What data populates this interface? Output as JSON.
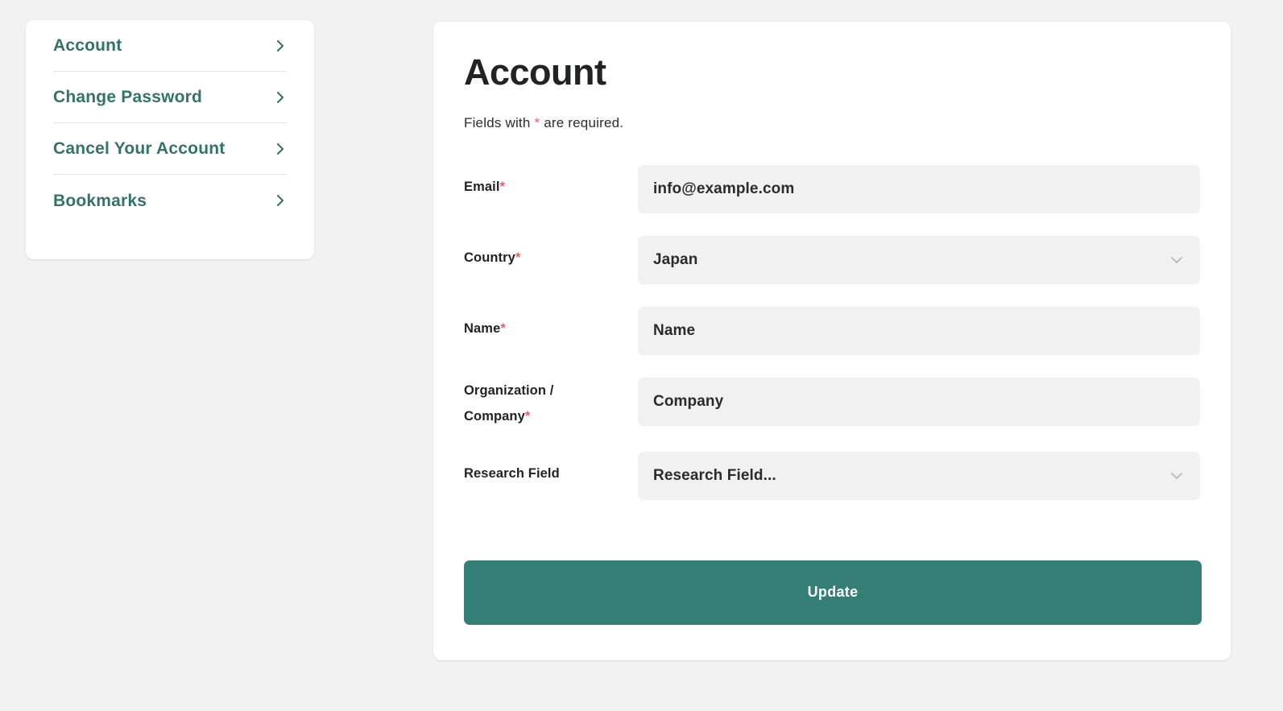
{
  "sidebar": {
    "items": [
      {
        "label": "Account",
        "icon": "chevron-right-icon"
      },
      {
        "label": "Change Password",
        "icon": "chevron-right-icon"
      },
      {
        "label": "Cancel Your Account",
        "icon": "chevron-right-icon"
      },
      {
        "label": "Bookmarks",
        "icon": "chevron-right-icon"
      }
    ]
  },
  "main": {
    "title": "Account",
    "required_note_prefix": "Fields with ",
    "required_note_star": "*",
    "required_note_suffix": " are required.",
    "fields": {
      "email": {
        "label": "Email",
        "required_marker": "*",
        "value": "info@example.com",
        "placeholder": "Email",
        "type": "text"
      },
      "country": {
        "label": "Country",
        "required_marker": "*",
        "value": "Japan",
        "type": "select",
        "icon": "chevron-down-icon"
      },
      "name": {
        "label": "Name",
        "required_marker": "*",
        "value": "",
        "placeholder": "Name",
        "type": "text"
      },
      "organization": {
        "label_line1": "Organization /",
        "label_line2": "Company",
        "required_marker": "*",
        "value": "",
        "placeholder": "Company",
        "type": "text"
      },
      "research_field": {
        "label": "Research Field",
        "required_marker": "",
        "value": "Research Field...",
        "type": "select",
        "icon": "chevron-down-icon"
      }
    },
    "submit_label": "Update"
  },
  "colors": {
    "page_background": "#f2f2f2",
    "card_background": "#ffffff",
    "accent_teal": "#357e78",
    "link_teal": "#36716a",
    "required_red": "#e4626f",
    "field_background": "#f1f1f1",
    "text_dark": "#2b2b2d"
  }
}
